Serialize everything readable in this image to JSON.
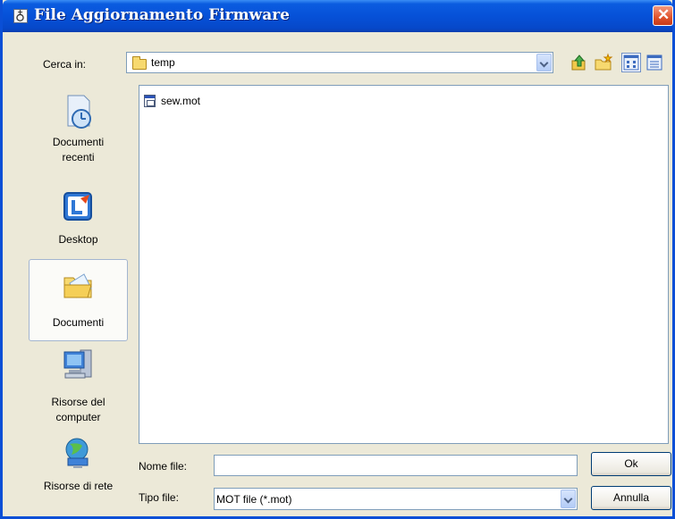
{
  "window": {
    "title": "File Aggiornamento Firmware"
  },
  "look_in": {
    "label": "Cerca in:",
    "value": "temp"
  },
  "toolbar": {
    "icons": [
      "up-one-level-icon",
      "new-folder-icon",
      "list-view-icon",
      "details-view-icon"
    ]
  },
  "places": [
    {
      "label_1": "Documenti",
      "label_2": "recenti",
      "icon": "recent-documents-icon"
    },
    {
      "label_1": "Desktop",
      "label_2": "",
      "icon": "desktop-icon"
    },
    {
      "label_1": "Documenti",
      "label_2": "",
      "icon": "my-documents-icon",
      "selected": true
    },
    {
      "label_1": "Risorse del",
      "label_2": "computer",
      "icon": "my-computer-icon"
    },
    {
      "label_1": "Risorse di rete",
      "label_2": "",
      "icon": "network-icon"
    }
  ],
  "files": [
    {
      "name": "sew.mot"
    }
  ],
  "filename": {
    "label": "Nome file:",
    "value": ""
  },
  "filetype": {
    "label": "Tipo file:",
    "value": "MOT file (*.mot)"
  },
  "buttons": {
    "ok": "Ok",
    "cancel": "Annulla"
  }
}
